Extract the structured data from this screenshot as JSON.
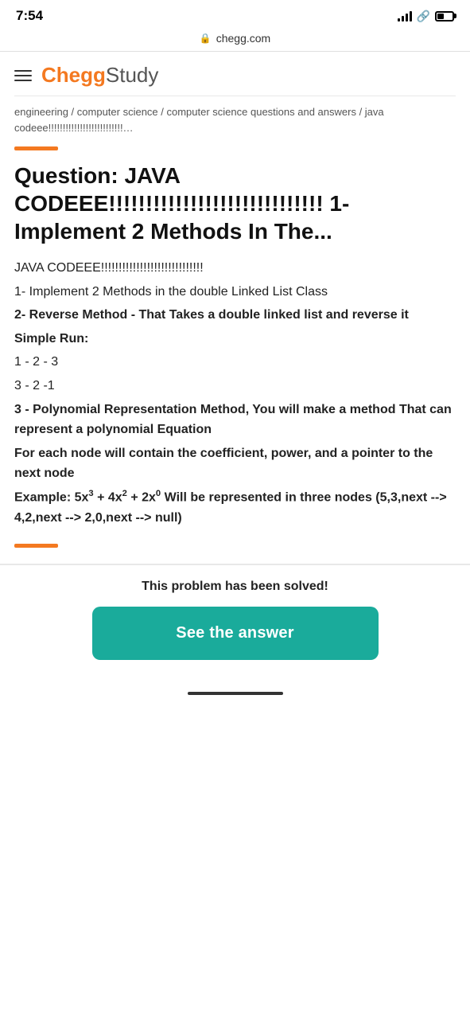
{
  "statusBar": {
    "time": "7:54",
    "url": "chegg.com"
  },
  "header": {
    "chegg": "Chegg",
    "study": "Study",
    "hamburgerLabel": "Menu"
  },
  "breadcrumb": {
    "text": "engineering / computer science / computer science questions and answers / java codeee!!!!!!!!!!!!!!!!!!!!!!!!!!…"
  },
  "question": {
    "label": "Question:",
    "title": " JAVA CODEEE!!!!!!!!!!!!!!!!!!!!!!!!!!!!! 1- Implement 2 Methods In The...",
    "body": {
      "line1": "JAVA CODEEE!!!!!!!!!!!!!!!!!!!!!!!!!!!!!",
      "line2": "1- Implement 2 Methods in the double Linked List Class",
      "line3": "2- Reverse Method - That Takes a double linked list and reverse it",
      "line4": "Simple Run:",
      "line5": "1 - 2 - 3",
      "line6": "3 - 2 -1",
      "line7": "3 - Polynomial Representation Method, You will make a method That can represent a polynomial Equation",
      "line8": "For each node will contain the coefficient, power, and a pointer to the next node",
      "line9_prefix": "Example: 5x",
      "line9_exp1": "3",
      "line9_mid1": " + 4x",
      "line9_exp2": "2",
      "line9_mid2": " + 2x",
      "line9_exp3": "0",
      "line9_suffix": " Will be represented in three nodes (5,3,next --> 4,2,next --> 2,0,next --> null)"
    }
  },
  "solvedBanner": {
    "text": "This problem has been solved!"
  },
  "answerButton": {
    "label": "See the answer"
  },
  "colors": {
    "orange": "#f47920",
    "teal": "#1aab9b"
  }
}
